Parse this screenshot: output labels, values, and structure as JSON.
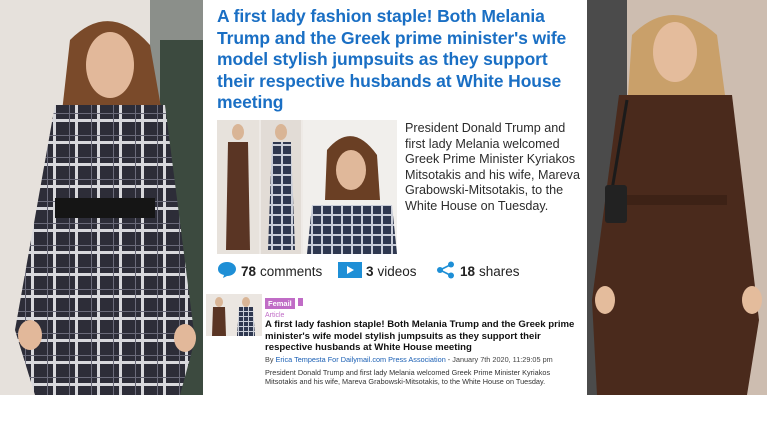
{
  "card": {
    "headline": "A first lady fashion staple! Both Melania Trump and the Greek prime minister's wife model stylish jumpsuits as they support their respective husbands at White House meeting",
    "summary": "President Donald Trump and first lady Melania welcomed Greek Prime Minister Kyriakos Mitsotakis and his wife, Mareva Grabowski-Mitsotakis, to the White House on Tuesday.",
    "stats": {
      "comments_count": "78",
      "comments_label": "comments",
      "videos_count": "3",
      "videos_label": "videos",
      "shares_count": "18",
      "shares_label": "shares"
    },
    "icons": [
      "comment-bubble-icon",
      "video-play-icon",
      "share-icon"
    ]
  },
  "snippet": {
    "tag": "Femail",
    "type": "Article",
    "title": "A first lady fashion staple! Both Melania Trump and the Greek prime minister's wife model stylish jumpsuits as they support their respective husbands at White House meeting",
    "byline_prefix": "By ",
    "author": "Erica Tempesta For Dailymail.com",
    "source": "Press Association",
    "date": " - January 7th 2020, 11:29:05 pm",
    "description": "President Donald Trump and first lady Melania welcomed Greek Prime Minister Kyriakos Mitsotakis and his wife, Mareva Grabowski-Mitsotakis, to the White House on Tuesday."
  },
  "colors": {
    "headline_blue": "#1a6fc4",
    "icon_blue": "#1e8fd6",
    "femail_purple": "#c06cc6"
  }
}
